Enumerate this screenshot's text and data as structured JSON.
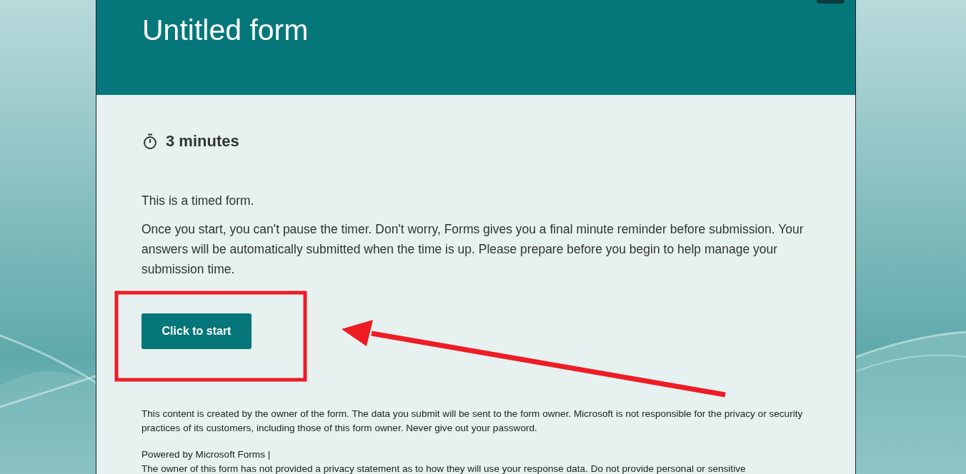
{
  "form": {
    "title": "Untitled form"
  },
  "timer": {
    "duration": "3 minutes"
  },
  "intro": "This is a timed form.",
  "description": "Once you start, you can't pause the timer. Don't worry, Forms gives you a final minute reminder before submission. Your answers will be automatically submitted when the time is up. Please prepare before you begin to help manage your submission time.",
  "start_button": {
    "label": "Click to start"
  },
  "footer": {
    "disclaimer": "This content is created by the owner of the form. The data you submit will be sent to the form owner. Microsoft is not responsible for the privacy or security practices of its customers, including those of this form owner. Never give out your password.",
    "powered_by": "Powered by Microsoft Forms |",
    "privacy_note": "The owner of this form has not provided a privacy statement as to how they will use your response data. Do not provide personal or sensitive"
  }
}
